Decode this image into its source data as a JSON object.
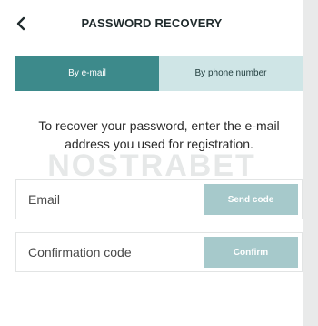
{
  "header": {
    "title": "PASSWORD RECOVERY",
    "back_icon": "chevron-left-icon"
  },
  "tabs": [
    {
      "label": "By e-mail",
      "active": true
    },
    {
      "label": "By phone number",
      "active": false
    }
  ],
  "instructions": "To recover your password, enter the e-mail address you used for registration.",
  "watermark": "NOSTRABET",
  "email_field": {
    "placeholder": "Email",
    "value": "",
    "button_label": "Send code"
  },
  "code_field": {
    "placeholder": "Confirmation code",
    "value": "",
    "button_label": "Confirm"
  },
  "colors": {
    "accent": "#3d8a8b",
    "tab_inactive": "#cfe5e6",
    "button_disabled": "#a6c9cb"
  }
}
